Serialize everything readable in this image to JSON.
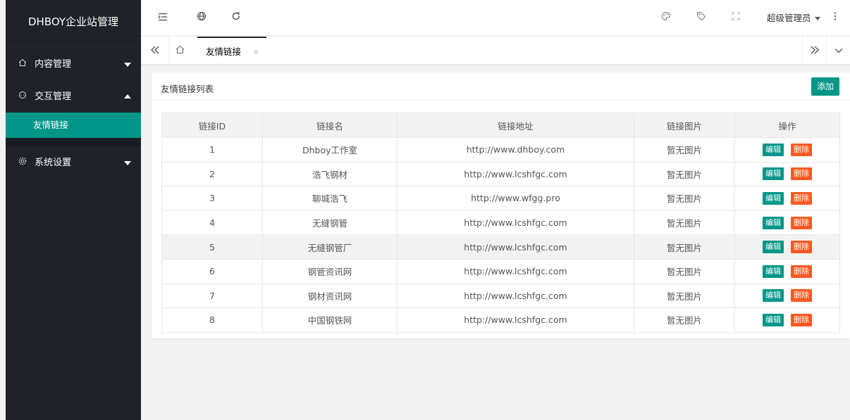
{
  "brand": "DHBOY企业站管理",
  "sidebar": {
    "items": [
      {
        "label": "内容管理"
      },
      {
        "label": "交互管理",
        "sub": [
          {
            "label": "友情链接"
          }
        ]
      },
      {
        "label": "系统设置"
      }
    ]
  },
  "header": {
    "user": "超级管理员"
  },
  "tabs": {
    "active": "友情链接",
    "close": "×"
  },
  "card": {
    "title": "友情链接列表",
    "add_label": "添加"
  },
  "table": {
    "headers": [
      "链接ID",
      "链接名",
      "链接地址",
      "链接图片",
      "操作"
    ],
    "edit_label": "编辑",
    "delete_label": "删除",
    "rows": [
      {
        "id": "1",
        "name": "Dhboy工作室",
        "url": "http://www.dhboy.com",
        "image": "暂无图片"
      },
      {
        "id": "2",
        "name": "浩飞钢材",
        "url": "http://www.lcshfgc.com",
        "image": "暂无图片"
      },
      {
        "id": "3",
        "name": "聊城浩飞",
        "url": "http://www.wfgg.pro",
        "image": "暂无图片"
      },
      {
        "id": "4",
        "name": "无缝钢管",
        "url": "http://www.lcshfgc.com",
        "image": "暂无图片"
      },
      {
        "id": "5",
        "name": "无缝钢管厂",
        "url": "http://www.lcshfgc.com",
        "image": "暂无图片"
      },
      {
        "id": "6",
        "name": "钢管资讯网",
        "url": "http://www.lcshfgc.com",
        "image": "暂无图片"
      },
      {
        "id": "7",
        "name": "钢材资讯网",
        "url": "http://www.lcshfgc.com",
        "image": "暂无图片"
      },
      {
        "id": "8",
        "name": "中国钢铁网",
        "url": "http://www.lcshfgc.com",
        "image": "暂无图片"
      }
    ]
  },
  "colors": {
    "sidebar_bg": "#20222a",
    "accent": "#009688",
    "danger": "#ff5722"
  },
  "icons": [
    "home-icon",
    "chat-icon",
    "gear-icon",
    "menu-icon",
    "globe-icon",
    "refresh-icon",
    "theme-icon",
    "tag-icon",
    "fullscreen-icon",
    "more-icon",
    "double-chevron-left-icon",
    "double-chevron-right-icon",
    "chevron-down-icon"
  ]
}
